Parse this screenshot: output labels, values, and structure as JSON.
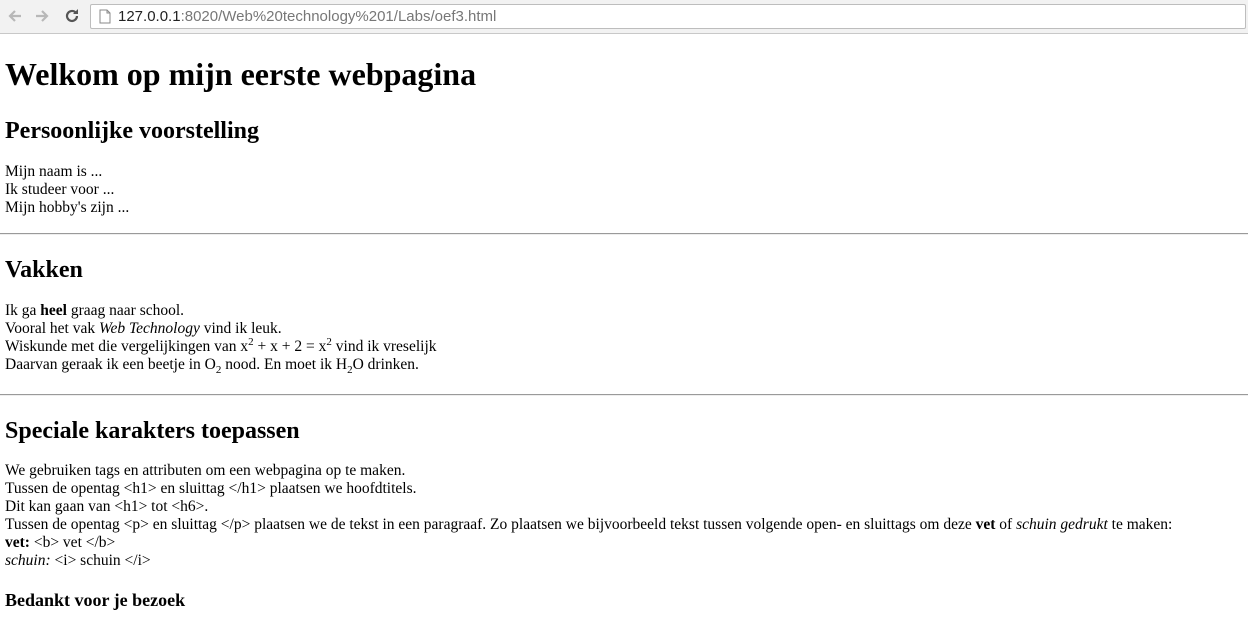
{
  "browser": {
    "url_host": "127.0.0.1",
    "url_rest": ":8020/Web%20technology%201/Labs/oef3.html"
  },
  "page": {
    "h1": "Welkom op mijn eerste webpagina",
    "section1": {
      "heading": "Persoonlijke voorstelling",
      "line1": "Mijn naam is ...",
      "line2": "Ik studeer voor ...",
      "line3": "Mijn hobby's zijn ..."
    },
    "section2": {
      "heading": "Vakken",
      "l1_a": "Ik ga ",
      "l1_b": "heel",
      "l1_c": " graag naar school.",
      "l2_a": "Vooral het vak ",
      "l2_b": "Web Technology",
      "l2_c": " vind ik leuk.",
      "l3_a": "Wiskunde met die vergelijkingen van x",
      "l3_sup1": "2",
      "l3_b": " + x + 2 = x",
      "l3_sup2": "2",
      "l3_c": " vind ik vreselijk",
      "l4_a": "Daarvan geraak ik een beetje in O",
      "l4_sub1": "2",
      "l4_b": " nood. En moet ik H",
      "l4_sub2": "2",
      "l4_c": "O drinken."
    },
    "section3": {
      "heading": "Speciale karakters toepassen",
      "l1": "We gebruiken tags en attributen om een webpagina op te maken.",
      "l2": "Tussen de opentag <h1> en sluittag </h1> plaatsen we hoofdtitels.",
      "l3": "Dit kan gaan van <h1> tot <h6>.",
      "l4_a": "Tussen de opentag <p> en sluittag </p> plaatsen we de tekst in een paragraaf. Zo plaatsen we bijvoorbeeld tekst tussen volgende open- en sluittags om deze ",
      "l4_b": "vet",
      "l4_c": " of ",
      "l4_d": "schuin gedrukt",
      "l4_e": " te maken:",
      "l5_a": "vet:",
      "l5_b": " <b> vet </b>",
      "l6_a": "schuin:",
      "l6_b": " <i> schuin </i>"
    },
    "footer": "Bedankt voor je bezoek"
  }
}
